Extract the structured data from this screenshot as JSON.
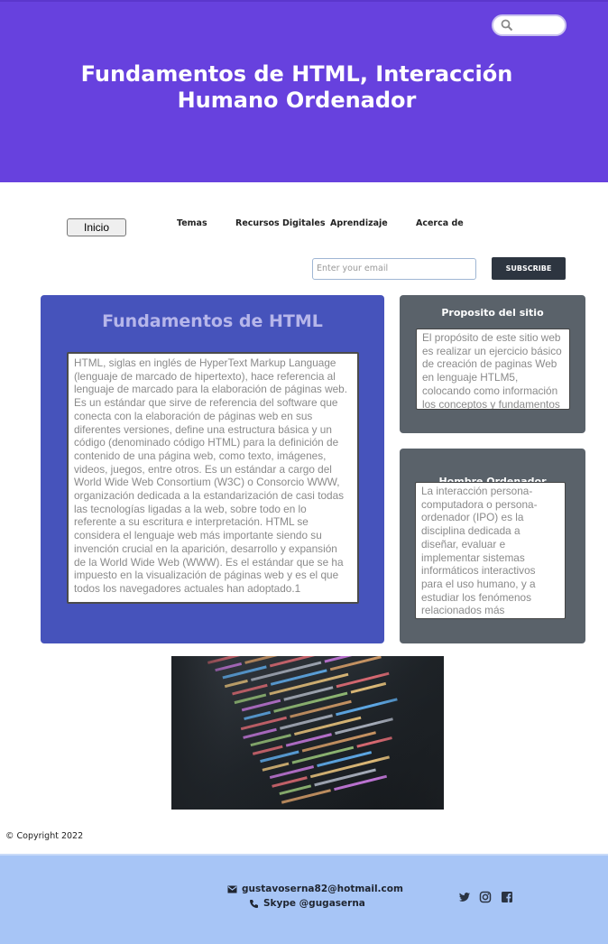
{
  "header": {
    "title": "Fundamentos de HTML, Interacción Humano Ordenador",
    "search_icon": "search-icon",
    "search_value": ""
  },
  "nav": {
    "inicio": "Inicio",
    "temas": "Temas",
    "recursos": "Recursos Digitales",
    "aprendizaje": "Aprendizaje",
    "acerca": "Acerca de"
  },
  "subscribe": {
    "email_placeholder": "Enter your email",
    "button_label": "SUBSCRIBE"
  },
  "main_card": {
    "title": "Fundamentos de HTML",
    "text": "HTML, siglas en inglés de HyperText Markup Language (lenguaje de marcado de hipertexto), hace referencia al lenguaje de marcado para la elaboración de páginas web. Es un estándar que sirve de referencia del software que conecta con la elaboración de páginas web en sus diferentes versiones, define una estructura básica y un código (denominado código HTML) para la definición de contenido de una página web, como texto, imágenes, videos, juegos, entre otros. Es un estándar a cargo del World Wide Web Consortium (W3C) o Consorcio WWW, organización dedicada a la estandarización de casi todas las tecnologías ligadas a la web, sobre todo en lo referente a su escritura e interpretación. HTML se considera el lenguaje web más importante siendo su invención crucial en la aparición, desarrollo y expansión de la World Wide Web (WWW). Es el estándar que se ha impuesto en la visualización de páginas web y es el que todos los navegadores actuales han adoptado.1"
  },
  "proposito_card": {
    "title": "Proposito del sitio",
    "text": "El propósito de este sitio web es realizar un ejercicio básico de creación de paginas Web en lenguaje HTLM5, colocando como información los conceptos y fundamentos"
  },
  "hombre_card": {
    "title": "Hombre Ordenador",
    "text": "La interacción persona-computadora o persona-ordenador (IPO) es la disciplina dedicada a diseñar, evaluar e implementar sistemas informáticos interactivos para el uso humano, y a estudiar los fenómenos relacionados más significativos."
  },
  "copyright": "© Copyright 2022",
  "footer": {
    "email": "gustavoserna82@hotmail.com",
    "skype": "Skype @gugaserna",
    "social_icons": [
      "twitter-icon",
      "instagram-icon",
      "facebook-icon"
    ]
  },
  "colors": {
    "hero": "#6741de",
    "main_card": "#4653bb",
    "side_card": "#5a626a",
    "footer": "#a7c5f6",
    "subscribe_button": "#2d3540"
  }
}
